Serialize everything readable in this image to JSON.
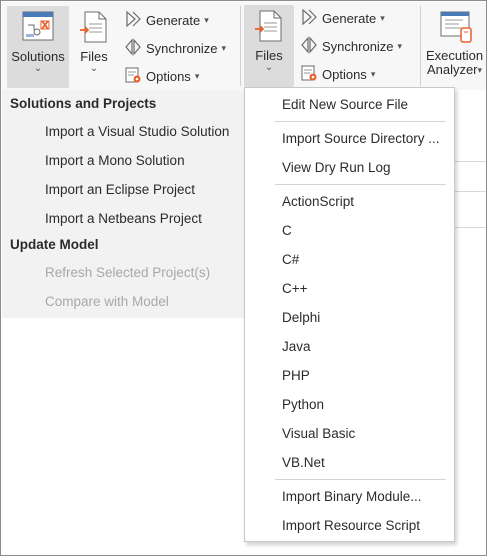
{
  "ribbon": {
    "solutions": {
      "label": "Solutions"
    },
    "files_left": {
      "label": "Files"
    },
    "generate_left": {
      "label": "Generate"
    },
    "synchronize_left": {
      "label": "Synchronize"
    },
    "options_left": {
      "label": "Options"
    },
    "files_active": {
      "label": "Files"
    },
    "generate_right": {
      "label": "Generate"
    },
    "synchronize_right": {
      "label": "Synchronize"
    },
    "options_right": {
      "label": "Options"
    },
    "execution_analyzer": {
      "label_line1": "Execution",
      "label_line2": "Analyzer"
    }
  },
  "solutions_menu": {
    "section1": "Solutions and Projects",
    "items1": [
      "Import a Visual Studio Solution",
      "Import a Mono Solution",
      "Import an Eclipse Project",
      "Import a Netbeans Project"
    ],
    "section2": "Update Model",
    "items2": [
      "Refresh Selected Project(s)",
      "Compare with Model"
    ]
  },
  "files_menu": {
    "group1": [
      "Edit New Source File"
    ],
    "group2": [
      "Import Source Directory ...",
      "View Dry Run Log"
    ],
    "languages": [
      "ActionScript",
      "C",
      "C#",
      "C++",
      "Delphi",
      "Java",
      "PHP",
      "Python",
      "Visual Basic",
      "VB.Net"
    ],
    "group4": [
      "Import Binary Module...",
      "Import Resource Script"
    ]
  },
  "colors": {
    "ribbon_bg": "#f7f7f7",
    "menu_panel_bg": "#f2f2f2",
    "active_button_bg": "#dcdcdc",
    "disabled_text": "#a8a8a8",
    "icon_accent": "#e8612c"
  }
}
